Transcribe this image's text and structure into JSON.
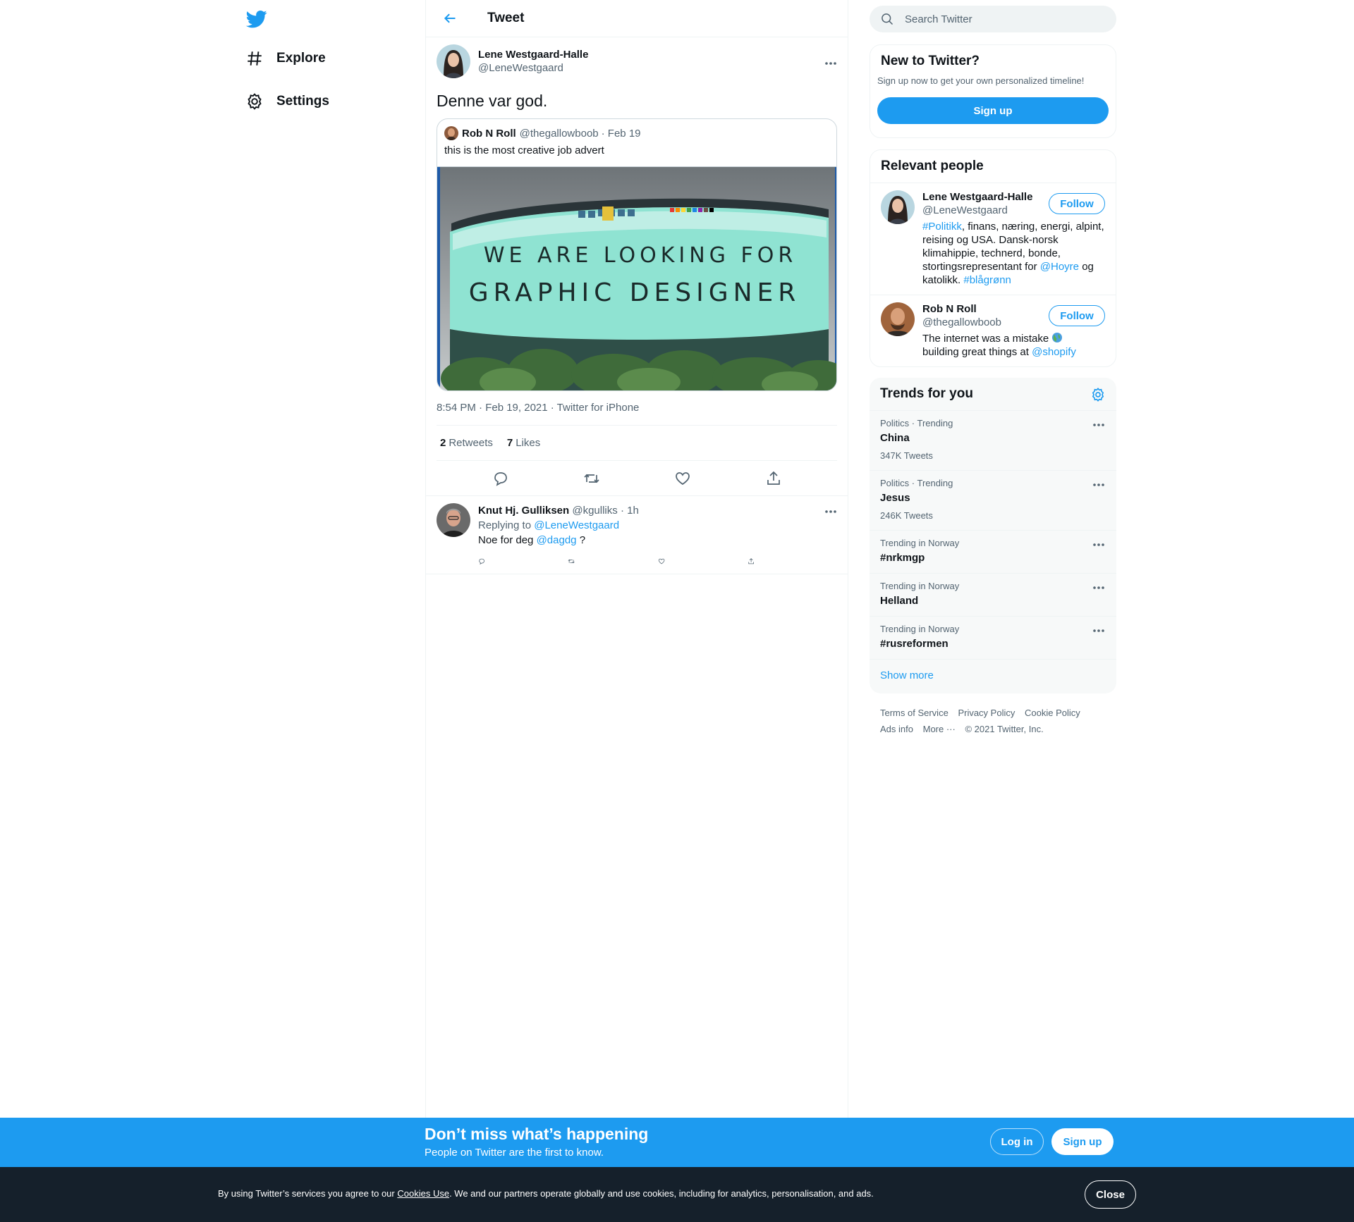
{
  "nav": {
    "explore_label": "Explore",
    "settings_label": "Settings"
  },
  "header": {
    "title": "Tweet"
  },
  "tweet": {
    "author_name": "Lene Westgaard-Halle",
    "author_handle": "@LeneWestgaard",
    "text": "Denne var god.",
    "quote": {
      "author_name": "Rob N Roll",
      "author_handle": "@thegallowboob",
      "date": "· Feb 19",
      "text": "this is the most creative job advert",
      "image_text_line1": "WE ARE LOOKING FOR",
      "image_text_line2": "GRAPHIC DESIGNER"
    },
    "meta": "8:54 PM · Feb 19, 2021 · Twitter for iPhone",
    "retweets_count": "2",
    "retweets_label": "Retweets",
    "likes_count": "7",
    "likes_label": "Likes"
  },
  "reply": {
    "author_name": "Knut Hj. Gulliksen",
    "author_handle": "@kgulliks",
    "time": "· 1h",
    "replying_label": "Replying to",
    "replying_to": "@LeneWestgaard",
    "text_before": "Noe for deg",
    "mention": "@dagdg",
    "text_after": "?"
  },
  "search": {
    "placeholder": "Search Twitter"
  },
  "new_to_twitter": {
    "title": "New to Twitter?",
    "subtitle": "Sign up now to get your own personalized timeline!",
    "signup_label": "Sign up"
  },
  "relevant_people": {
    "title": "Relevant people",
    "follow_label": "Follow",
    "people": [
      {
        "name": "Lene Westgaard-Halle",
        "handle": "@LeneWestgaard",
        "bio_tag1": "#Politikk",
        "bio_text1": ", finans, næring, energi, alpint, reising og USA. Dansk-norsk klimahippie, technerd, bonde, stortingsrepresentant for",
        "bio_mention": "@Hoyre",
        "bio_text2": "og katolikk.",
        "bio_tag2": "#blågrønn"
      },
      {
        "name": "Rob N Roll",
        "handle": "@thegallowboob",
        "bio_text1": "The internet was a mistake",
        "bio_text2": "building great things at",
        "bio_mention": "@shopify"
      }
    ]
  },
  "trends": {
    "title": "Trends for you",
    "items": [
      {
        "meta": "Politics · Trending",
        "name": "China",
        "count": "347K Tweets"
      },
      {
        "meta": "Politics · Trending",
        "name": "Jesus",
        "count": "246K Tweets"
      },
      {
        "meta": "Trending in Norway",
        "name": "#nrkmgp",
        "count": ""
      },
      {
        "meta": "Trending in Norway",
        "name": "Helland",
        "count": ""
      },
      {
        "meta": "Trending in Norway",
        "name": "#rusreformen",
        "count": ""
      }
    ],
    "show_more": "Show more"
  },
  "footer": {
    "terms": "Terms of Service",
    "privacy": "Privacy Policy",
    "cookie": "Cookie Policy",
    "ads": "Ads info",
    "more": "More ···",
    "copyright": "© 2021 Twitter, Inc."
  },
  "promo": {
    "title": "Don’t miss what’s happening",
    "subtitle": "People on Twitter are the first to know.",
    "login_label": "Log in",
    "signup_label": "Sign up"
  },
  "cookie": {
    "text_before": "By using Twitter’s services you agree to our",
    "link": "Cookies Use",
    "text_after": ". We and our partners operate globally and use cookies, including for analytics, personalisation, and ads.",
    "close_label": "Close"
  },
  "colors": {
    "accent": "#1d9bf0",
    "cookie_bar": "#15202b"
  }
}
